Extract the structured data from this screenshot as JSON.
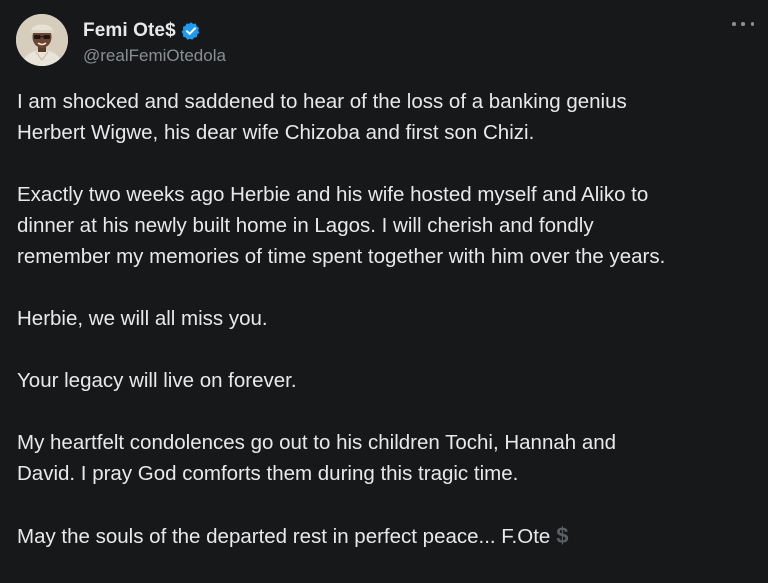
{
  "author": {
    "display_name": "Femi Ote$",
    "handle": "@realFemiOtedola",
    "verified": true,
    "verified_color": "#1d9bf0"
  },
  "menu": {
    "icon": "more-horizontal-icon"
  },
  "tweet": {
    "paragraphs": [
      [
        "I am shocked and saddened to hear of the loss of a banking genius",
        "Herbert Wigwe, his dear wife Chizoba and first son Chizi."
      ],
      [
        "Exactly two weeks ago Herbie and his wife hosted myself and Aliko to",
        "dinner at his newly built home in Lagos. I will cherish and fondly",
        "remember my memories of time spent together with him over the years."
      ],
      [
        "Herbie, we will all miss you."
      ],
      [
        "Your legacy will live on forever."
      ],
      [
        "My heartfelt condolences go out to his children Tochi, Hannah and",
        "David. I pray God comforts them during this tragic time."
      ],
      [
        "May the souls of the departed rest in perfect peace... F.Ote"
      ]
    ],
    "trailing_symbol": "$"
  },
  "colors": {
    "background": "#16181a",
    "text": "#e7e9ea",
    "secondary": "#8b8f94"
  }
}
